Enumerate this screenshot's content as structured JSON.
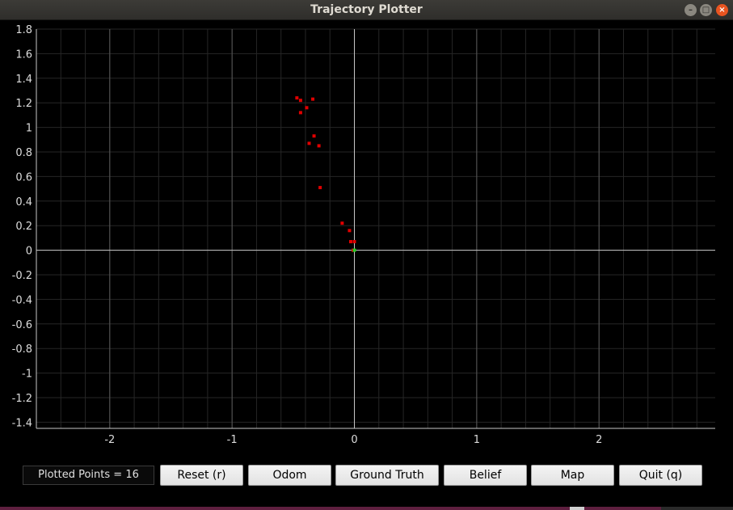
{
  "window": {
    "title": "Trajectory Plotter",
    "minimize_glyph": "–",
    "maximize_glyph": "□",
    "close_glyph": "×"
  },
  "chart_data": {
    "type": "scatter",
    "title": "",
    "xlabel": "",
    "ylabel": "",
    "xlim": [
      -2.6,
      2.95
    ],
    "ylim": [
      -1.45,
      1.8
    ],
    "grid": true,
    "x_ticks": [
      -2,
      -1,
      0,
      1,
      2
    ],
    "x_tick_labels": [
      "-2",
      "-1",
      "0",
      "1",
      "2"
    ],
    "y_ticks": [
      1.8,
      1.6,
      1.4,
      1.2,
      1,
      0.8,
      0.6,
      0.4,
      0.2,
      0,
      -0.2,
      -0.4,
      -0.6,
      -0.8,
      -1,
      -1.2,
      -1.4
    ],
    "y_tick_labels": [
      "1.8",
      "1.6",
      "1.4",
      "1.2",
      "1",
      "0.8",
      "0.6",
      "0.4",
      "0.2",
      "0",
      "-0.2",
      "-0.4",
      "-0.6",
      "-0.8",
      "-1",
      "-1.2",
      "-1.4"
    ],
    "series": [
      {
        "color": "#e00000",
        "points": [
          {
            "x": -0.47,
            "y": 1.24
          },
          {
            "x": -0.44,
            "y": 1.22
          },
          {
            "x": -0.34,
            "y": 1.23
          },
          {
            "x": -0.39,
            "y": 1.16
          },
          {
            "x": -0.44,
            "y": 1.12
          },
          {
            "x": -0.33,
            "y": 0.93
          },
          {
            "x": -0.37,
            "y": 0.87
          },
          {
            "x": -0.29,
            "y": 0.85
          },
          {
            "x": -0.28,
            "y": 0.51
          },
          {
            "x": -0.1,
            "y": 0.22
          },
          {
            "x": -0.04,
            "y": 0.16
          },
          {
            "x": -0.03,
            "y": 0.07
          },
          {
            "x": 0.0,
            "y": 0.07
          },
          {
            "x": -0.01,
            "y": 0.0
          }
        ]
      },
      {
        "color": "#20d020",
        "points": [
          {
            "x": 0.0,
            "y": 0.0
          }
        ]
      }
    ]
  },
  "controls": {
    "points_counter": "Plotted Points = 16",
    "buttons": [
      {
        "id": "reset",
        "label": "Reset (r)"
      },
      {
        "id": "odom",
        "label": "Odom"
      },
      {
        "id": "ground-truth",
        "label": "Ground Truth"
      },
      {
        "id": "belief",
        "label": "Belief"
      },
      {
        "id": "map",
        "label": "Map"
      },
      {
        "id": "quit",
        "label": "Quit (q)"
      }
    ]
  },
  "colors": {
    "plot_background": "#000000",
    "axis": "#c8c8c8",
    "major_grid": "#5a5a5a",
    "minor_grid": "#262626",
    "tick_label": "#dcdcdc"
  }
}
